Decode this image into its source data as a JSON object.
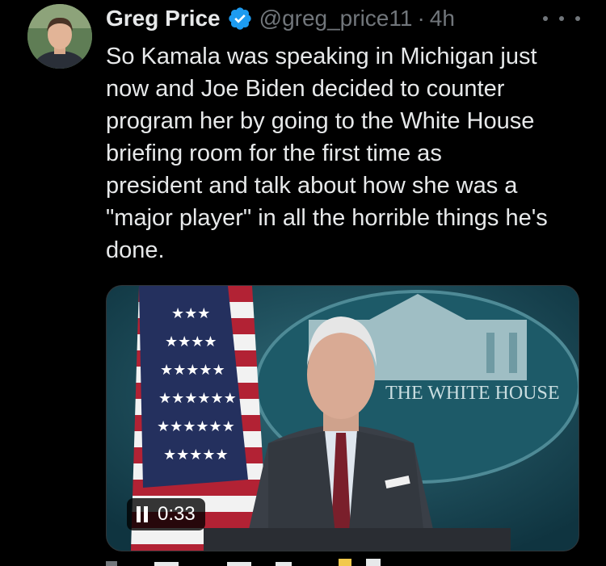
{
  "tweet": {
    "author_name": "Greg Price",
    "handle": "@greg_price11",
    "separator": "·",
    "time": "4h",
    "text": "So Kamala was speaking in Michigan just\nnow and Joe Biden decided to counter\nprogram her by going to the White House\nbriefing room for the first time as\npresident and talk about how she was a\n\"major player\" in all the horrible things he's\ndone.",
    "verified_color": "#1d9bf0"
  },
  "media": {
    "duration": "0:33",
    "backdrop_text": "THE WHITE HOUSE"
  },
  "icons": {
    "verified": "verified-badge-icon",
    "more": "more-options-icon",
    "pause": "pause-icon"
  }
}
